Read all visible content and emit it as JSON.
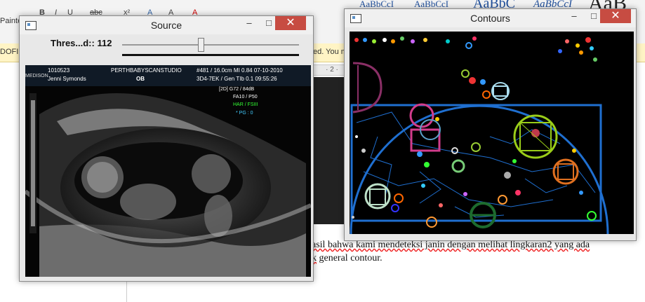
{
  "word": {
    "ribbon_left": "Painte",
    "format_buttons": [
      "B",
      "I",
      "U",
      "abc",
      "x²",
      "A",
      "A",
      "A"
    ],
    "style_samples": [
      "AaBbCcI",
      "AaBbCcI",
      "AaBbC",
      "AaBbCcI",
      "AaB"
    ],
    "warning_left": "DOFIN",
    "warning_right": "ed. You m",
    "ruler_mark": "· 2 ·",
    "body_line1": "asil bahwa kami mendeteksi janin dengan melihat lingkaran2 yang ada",
    "body_line2": "general contour.",
    "body_line2_prefix": "k"
  },
  "source_window": {
    "title": "Source",
    "minimize": "–",
    "maximize": "□",
    "close": "✕",
    "trackbar_label": "Thres...d:: 112",
    "trackbar_value": 112,
    "trackbar_max": 255,
    "scan_overlay": {
      "left_col": [
        "MEDISON",
        "1010523",
        "Jenni Symonds"
      ],
      "center_top": "PERTHBABYSCANSTUDIO",
      "center_mode": "OB",
      "row1": "#481  / 16.0cm MI 0.84  07-10-2010",
      "row2": "3D4-7EK /  Gen  TIb 0.1  09:55:26",
      "params": [
        "[2D] G72 / 84dB",
        "FA10 / P50",
        "HAR / FSIII"
      ],
      "pg": "* PG : 0"
    }
  },
  "contours_window": {
    "title": "Contours",
    "minimize": "–",
    "maximize": "□",
    "close": "✕"
  },
  "colors": {
    "close_red": "#c74c42",
    "contour_blue": "#1f6fd0",
    "warning_yellow": "#fff4c5"
  }
}
